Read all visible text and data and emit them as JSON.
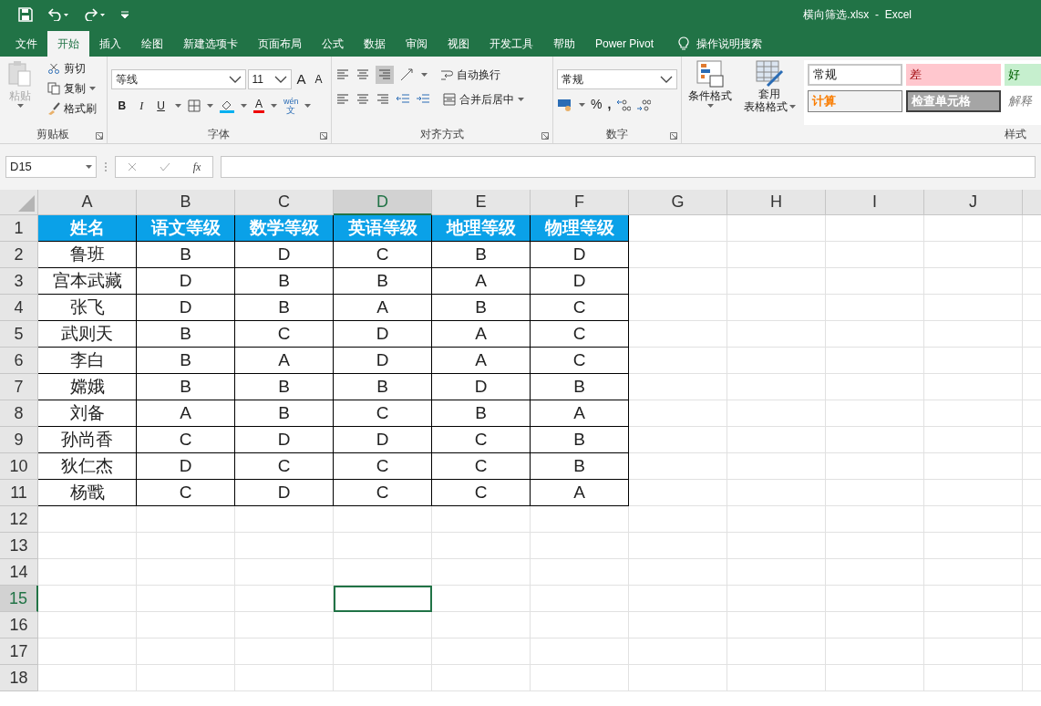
{
  "window": {
    "title": "横向筛选.xlsx  -  Excel"
  },
  "tabs": [
    {
      "label": "文件",
      "selected": false
    },
    {
      "label": "开始",
      "selected": true
    },
    {
      "label": "插入",
      "selected": false
    },
    {
      "label": "绘图",
      "selected": false
    },
    {
      "label": "新建选项卡",
      "selected": false
    },
    {
      "label": "页面布局",
      "selected": false
    },
    {
      "label": "公式",
      "selected": false
    },
    {
      "label": "数据",
      "selected": false
    },
    {
      "label": "审阅",
      "selected": false
    },
    {
      "label": "视图",
      "selected": false
    },
    {
      "label": "开发工具",
      "selected": false
    },
    {
      "label": "帮助",
      "selected": false
    },
    {
      "label": "Power Pivot",
      "selected": false
    }
  ],
  "tell_me": "操作说明搜索",
  "ribbon": {
    "clipboard": {
      "label": "剪贴板",
      "paste": "粘贴",
      "cut": "剪切",
      "copy": "复制",
      "format_painter": "格式刷"
    },
    "font": {
      "label": "字体",
      "font_name": "等线",
      "font_size": "11",
      "grow": "A",
      "shrink": "A",
      "bold": "B",
      "italic": "I",
      "underline": "U",
      "font_color": "A",
      "phonetic_top": "wén",
      "phonetic_bottom": "文"
    },
    "alignment": {
      "label": "对齐方式",
      "wrap": "自动换行",
      "merge": "合并后居中"
    },
    "number": {
      "label": "数字",
      "format": "常规",
      "percent": "%",
      "comma": ","
    },
    "styles": {
      "label": "样式",
      "conditional": "条件格式",
      "table_top": "套用",
      "table_bottom": "表格格式",
      "cells": [
        {
          "label": "常规",
          "kind": "normal"
        },
        {
          "label": "差",
          "kind": "bad"
        },
        {
          "label": "好",
          "kind": "good"
        },
        {
          "label": "计算",
          "kind": "calc"
        },
        {
          "label": "检查单元格",
          "kind": "check"
        },
        {
          "label": "解释",
          "kind": "explain"
        }
      ]
    }
  },
  "formula_bar": {
    "name_box": "D15",
    "fx": "fx"
  },
  "columns": [
    {
      "label": "A",
      "selected": false
    },
    {
      "label": "B",
      "selected": false
    },
    {
      "label": "C",
      "selected": false
    },
    {
      "label": "D",
      "selected": true
    },
    {
      "label": "E",
      "selected": false
    },
    {
      "label": "F",
      "selected": false
    },
    {
      "label": "G",
      "selected": false
    },
    {
      "label": "H",
      "selected": false
    },
    {
      "label": "I",
      "selected": false
    },
    {
      "label": "J",
      "selected": false
    }
  ],
  "rows": [
    {
      "label": "1",
      "selected": false
    },
    {
      "label": "2",
      "selected": false
    },
    {
      "label": "3",
      "selected": false
    },
    {
      "label": "4",
      "selected": false
    },
    {
      "label": "5",
      "selected": false
    },
    {
      "label": "6",
      "selected": false
    },
    {
      "label": "7",
      "selected": false
    },
    {
      "label": "8",
      "selected": false
    },
    {
      "label": "9",
      "selected": false
    },
    {
      "label": "10",
      "selected": false
    },
    {
      "label": "11",
      "selected": false
    },
    {
      "label": "12",
      "selected": false
    },
    {
      "label": "13",
      "selected": false
    },
    {
      "label": "14",
      "selected": false
    },
    {
      "label": "15",
      "selected": true
    },
    {
      "label": "16",
      "selected": false
    },
    {
      "label": "17",
      "selected": false
    },
    {
      "label": "18",
      "selected": false
    }
  ],
  "table": {
    "header": [
      "姓名",
      "语文等级",
      "数学等级",
      "英语等级",
      "地理等级",
      "物理等级"
    ],
    "rows": [
      [
        "鲁班",
        "B",
        "D",
        "C",
        "B",
        "D"
      ],
      [
        "宫本武藏",
        "D",
        "B",
        "B",
        "A",
        "D"
      ],
      [
        "张飞",
        "D",
        "B",
        "A",
        "B",
        "C"
      ],
      [
        "武则天",
        "B",
        "C",
        "D",
        "A",
        "C"
      ],
      [
        "李白",
        "B",
        "A",
        "D",
        "A",
        "C"
      ],
      [
        "嫦娥",
        "B",
        "B",
        "B",
        "D",
        "B"
      ],
      [
        "刘备",
        "A",
        "B",
        "C",
        "B",
        "A"
      ],
      [
        "孙尚香",
        "C",
        "D",
        "D",
        "C",
        "B"
      ],
      [
        "狄仁杰",
        "D",
        "C",
        "C",
        "C",
        "B"
      ],
      [
        "杨戬",
        "C",
        "D",
        "C",
        "C",
        "A"
      ]
    ]
  }
}
